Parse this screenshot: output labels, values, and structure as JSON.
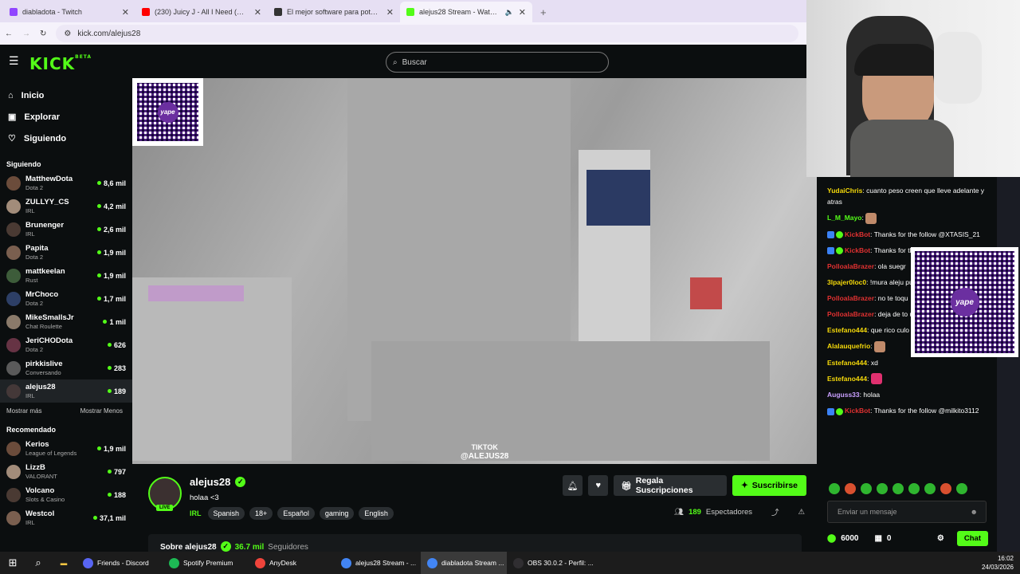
{
  "browser": {
    "tabs": [
      {
        "title": "diabladota - Twitch",
        "color": "#9146ff"
      },
      {
        "title": "(230) Juicy J - All I Need (One M",
        "color": "#ff0000"
      },
      {
        "title": "El mejor software para potenci",
        "color": "#333333"
      },
      {
        "title": "alejus28 Stream - Watch Li",
        "color": "#53fc18"
      }
    ],
    "url": "kick.com/alejus28"
  },
  "search": {
    "placeholder": "Buscar"
  },
  "nav": {
    "inicio": "Inicio",
    "explorar": "Explorar",
    "siguiendo": "Siguiendo"
  },
  "following_header": "Siguiendo",
  "following": [
    {
      "name": "MatthewDota",
      "category": "Dota 2",
      "viewers": "8,6 mil"
    },
    {
      "name": "ZULLYY_CS",
      "category": "IRL",
      "viewers": "4,2 mil"
    },
    {
      "name": "Brunenger",
      "category": "IRL",
      "viewers": "2,6 mil"
    },
    {
      "name": "Papita",
      "category": "Dota 2",
      "viewers": "1,9 mil"
    },
    {
      "name": "mattkeelan",
      "category": "Rust",
      "viewers": "1,9 mil"
    },
    {
      "name": "MrChoco",
      "category": "Dota 2",
      "viewers": "1,7 mil"
    },
    {
      "name": "MikeSmallsJr",
      "category": "Chat Roulette",
      "viewers": "1 mil"
    },
    {
      "name": "JeriCHODota",
      "category": "Dota 2",
      "viewers": "626"
    },
    {
      "name": "pirkkislive",
      "category": "Conversando",
      "viewers": "283"
    },
    {
      "name": "alejus28",
      "category": "IRL",
      "viewers": "189"
    }
  ],
  "show_more": "Mostrar más",
  "show_less": "Mostrar Menos",
  "recommended_header": "Recomendado",
  "recommended": [
    {
      "name": "Kerios",
      "category": "League of Legends",
      "viewers": "1,9 mil"
    },
    {
      "name": "LizzB",
      "category": "VALORANT",
      "viewers": "797"
    },
    {
      "name": "Volcano",
      "category": "Slots & Casino",
      "viewers": "188"
    },
    {
      "name": "Westcol",
      "category": "IRL",
      "viewers": "37,1 mil"
    }
  ],
  "video": {
    "tiktok_label": "TIKTOK",
    "tiktok_handle": "@ALEJUS28",
    "qr_brand": "yape"
  },
  "stream": {
    "streamer": "alejus28",
    "title": "holaa <3",
    "live_label": "LIVE",
    "category": "IRL",
    "tags": [
      "Spanish",
      "18+",
      "Español",
      "gaming",
      "English"
    ],
    "gift_label": "Regala Suscripciones",
    "subscribe_label": "Suscribirse",
    "viewers_count": "189",
    "viewers_label": "Espectadores",
    "about_label": "Sobre alejus28",
    "followers_count": "36.7 mil",
    "followers_label": "Seguidores"
  },
  "chat": {
    "messages": [
      {
        "user": "YudaiChris",
        "color": "#f5d90a",
        "text": "cuanto peso creen que lleve adelante y atras"
      },
      {
        "user": "L_M_Mayo",
        "color": "#53fc18",
        "text": ""
      },
      {
        "user": "KickBot",
        "color": "#e03131",
        "text": "Thanks for the follow @XTASIS_21",
        "bot": true
      },
      {
        "user": "KickBot",
        "color": "#e03131",
        "text": "Thanks for the follow @Auguss33",
        "bot": true
      },
      {
        "user": "PolloalaBrazer",
        "color": "#e03131",
        "text": "ola suegr"
      },
      {
        "user": "3lpajer0loc0",
        "color": "#f5d90a",
        "text": "!mura aleju puedo pedir una foto o tu"
      },
      {
        "user": "PolloalaBrazer",
        "color": "#e03131",
        "text": "no te toqu"
      },
      {
        "user": "PolloalaBrazer",
        "color": "#e03131",
        "text": "deja de to uñas"
      },
      {
        "user": "Estefano444",
        "color": "#f5d90a",
        "text": "que rico culo csm"
      },
      {
        "user": "Alalauquefrio",
        "color": "#f5d90a",
        "text": ""
      },
      {
        "user": "Estefano444",
        "color": "#f5d90a",
        "text": "xd"
      },
      {
        "user": "Estefano444",
        "color": "#f5d90a",
        "text": ""
      },
      {
        "user": "Auguss33",
        "color": "#c9a0ff",
        "text": "holaa"
      },
      {
        "user": "KickBot",
        "color": "#e03131",
        "text": "Thanks for the follow @milkito3112",
        "bot": true
      }
    ],
    "input_placeholder": "Enviar un mensaje",
    "points": "6000",
    "other_count": "0",
    "chat_button": "Chat"
  },
  "taskbar": {
    "items": [
      {
        "label": "Friends - Discord",
        "color": "#5865f2"
      },
      {
        "label": "Spotify Premium",
        "color": "#1db954"
      },
      {
        "label": "AnyDesk",
        "color": "#ef443b"
      },
      {
        "label": "alejus28 Stream - ...",
        "color": "#4285f4"
      },
      {
        "label": "diabladota Stream ...",
        "color": "#4285f4"
      },
      {
        "label": "OBS 30.0.2 - Perfil: ...",
        "color": "#302e31"
      }
    ],
    "time": "16:02",
    "date": "24/03/2026"
  }
}
